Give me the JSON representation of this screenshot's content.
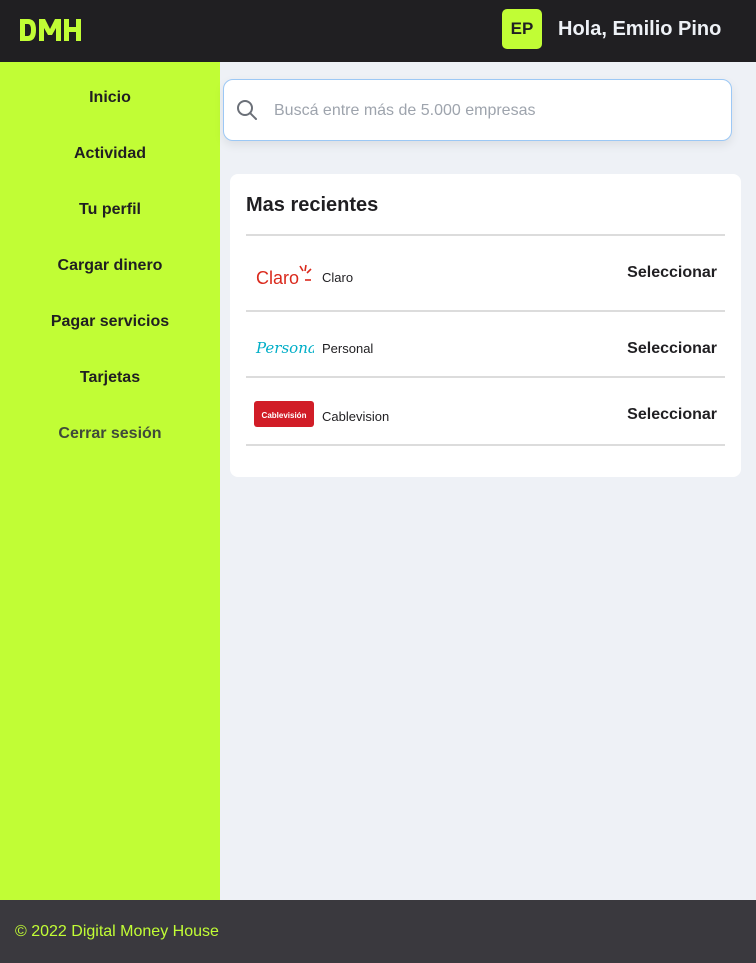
{
  "header": {
    "logo_text": "DMH",
    "avatar_initials": "EP",
    "greeting": "Hola, Emilio Pino"
  },
  "sidebar": {
    "items": [
      {
        "label": "Inicio"
      },
      {
        "label": "Actividad"
      },
      {
        "label": "Tu perfil"
      },
      {
        "label": "Cargar dinero"
      },
      {
        "label": "Pagar servicios"
      },
      {
        "label": "Tarjetas"
      },
      {
        "label": "Cerrar sesión"
      }
    ]
  },
  "search": {
    "placeholder": "Buscá entre más de 5.000 empresas",
    "value": ""
  },
  "recent": {
    "title": "Mas recientes",
    "items": [
      {
        "name": "Claro",
        "logo": "claro-logo",
        "logo_text": "Claro",
        "action": "Seleccionar"
      },
      {
        "name": "Personal",
        "logo": "personal-logo",
        "logo_text": "Personal",
        "action": "Seleccionar"
      },
      {
        "name": "Cablevision",
        "logo": "cablevision-logo",
        "logo_text": "Cablevisión",
        "action": "Seleccionar"
      }
    ]
  },
  "footer": {
    "copyright": "© 2022 Digital Money House"
  },
  "colors": {
    "accent": "#c1fd35",
    "dark": "#201f22",
    "background": "#eef1f6"
  }
}
